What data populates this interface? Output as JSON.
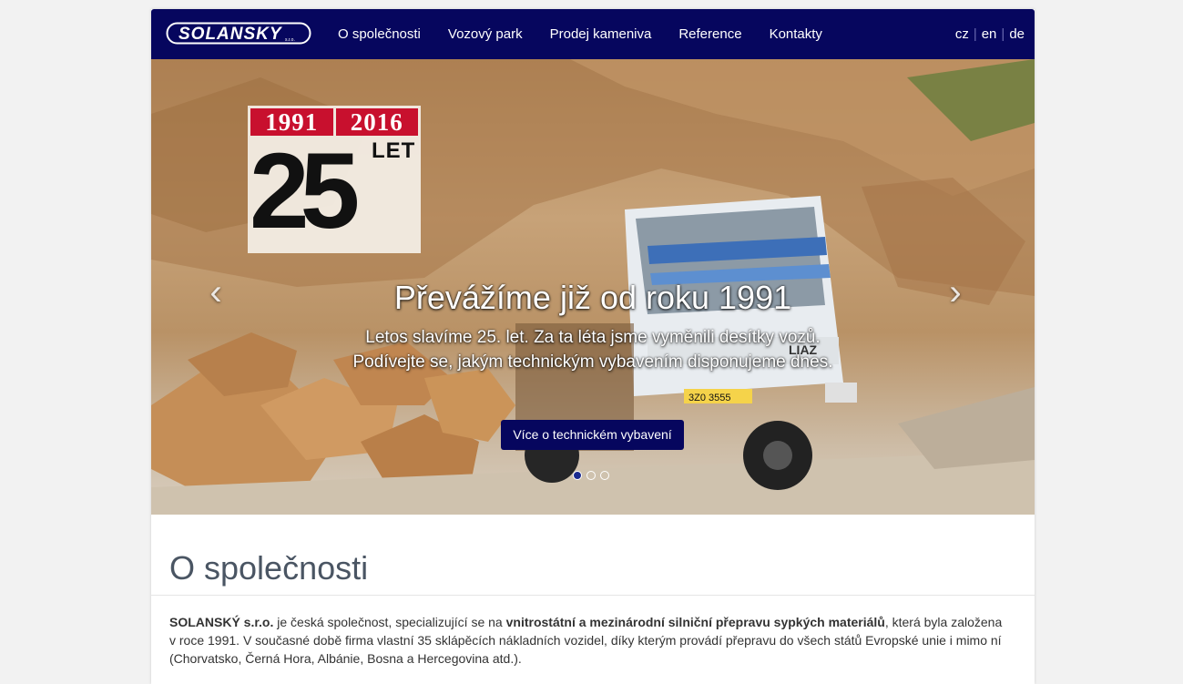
{
  "brand": {
    "logo_text": "SOLANSKY",
    "logo_sub": "s.r.o."
  },
  "nav": {
    "items": [
      {
        "label": "O společnosti"
      },
      {
        "label": "Vozový park"
      },
      {
        "label": "Prodej kameniva"
      },
      {
        "label": "Reference"
      },
      {
        "label": "Kontakty"
      }
    ],
    "languages": [
      "cz",
      "en",
      "de"
    ]
  },
  "hero": {
    "badge": {
      "year_from": "1991",
      "year_to": "2016",
      "number": "25",
      "unit": "LET"
    },
    "title": "Převážíme již od roku 1991",
    "text": "Letos slavíme 25. let. Za ta léta jsme vyměnili desítky vozů. Podívejte se, jakým technickým vybavením disponujeme dnes.",
    "button": "Více o technickém vybavení",
    "truck_plate": "3Z0 3555",
    "truck_brand": "LIAZ",
    "prev_arrow": "‹",
    "next_arrow": "›",
    "slides_total": 3,
    "slide_active": 1
  },
  "section": {
    "title": "O společnosti",
    "company": "SOLANSKÝ s.r.o.",
    "text_1": " je česká společnost, specializující se na ",
    "highlight": "vnitrostátní a mezinárodní silniční přepravu sypkých materiálů",
    "text_2": ", která byla založena v roce 1991. V současné době firma vlastní 35 sklápěcích nákladních vozidel, díky kterým provádí přepravu do všech států Evropské unie i mimo ní (Chorvatsko, Černá Hora, Albánie, Bosna a Hercegovina atd.)."
  },
  "colors": {
    "navbar": "#06065e",
    "accent": "#06065e",
    "badge_red": "#c8102e",
    "heading": "#4a5563"
  }
}
